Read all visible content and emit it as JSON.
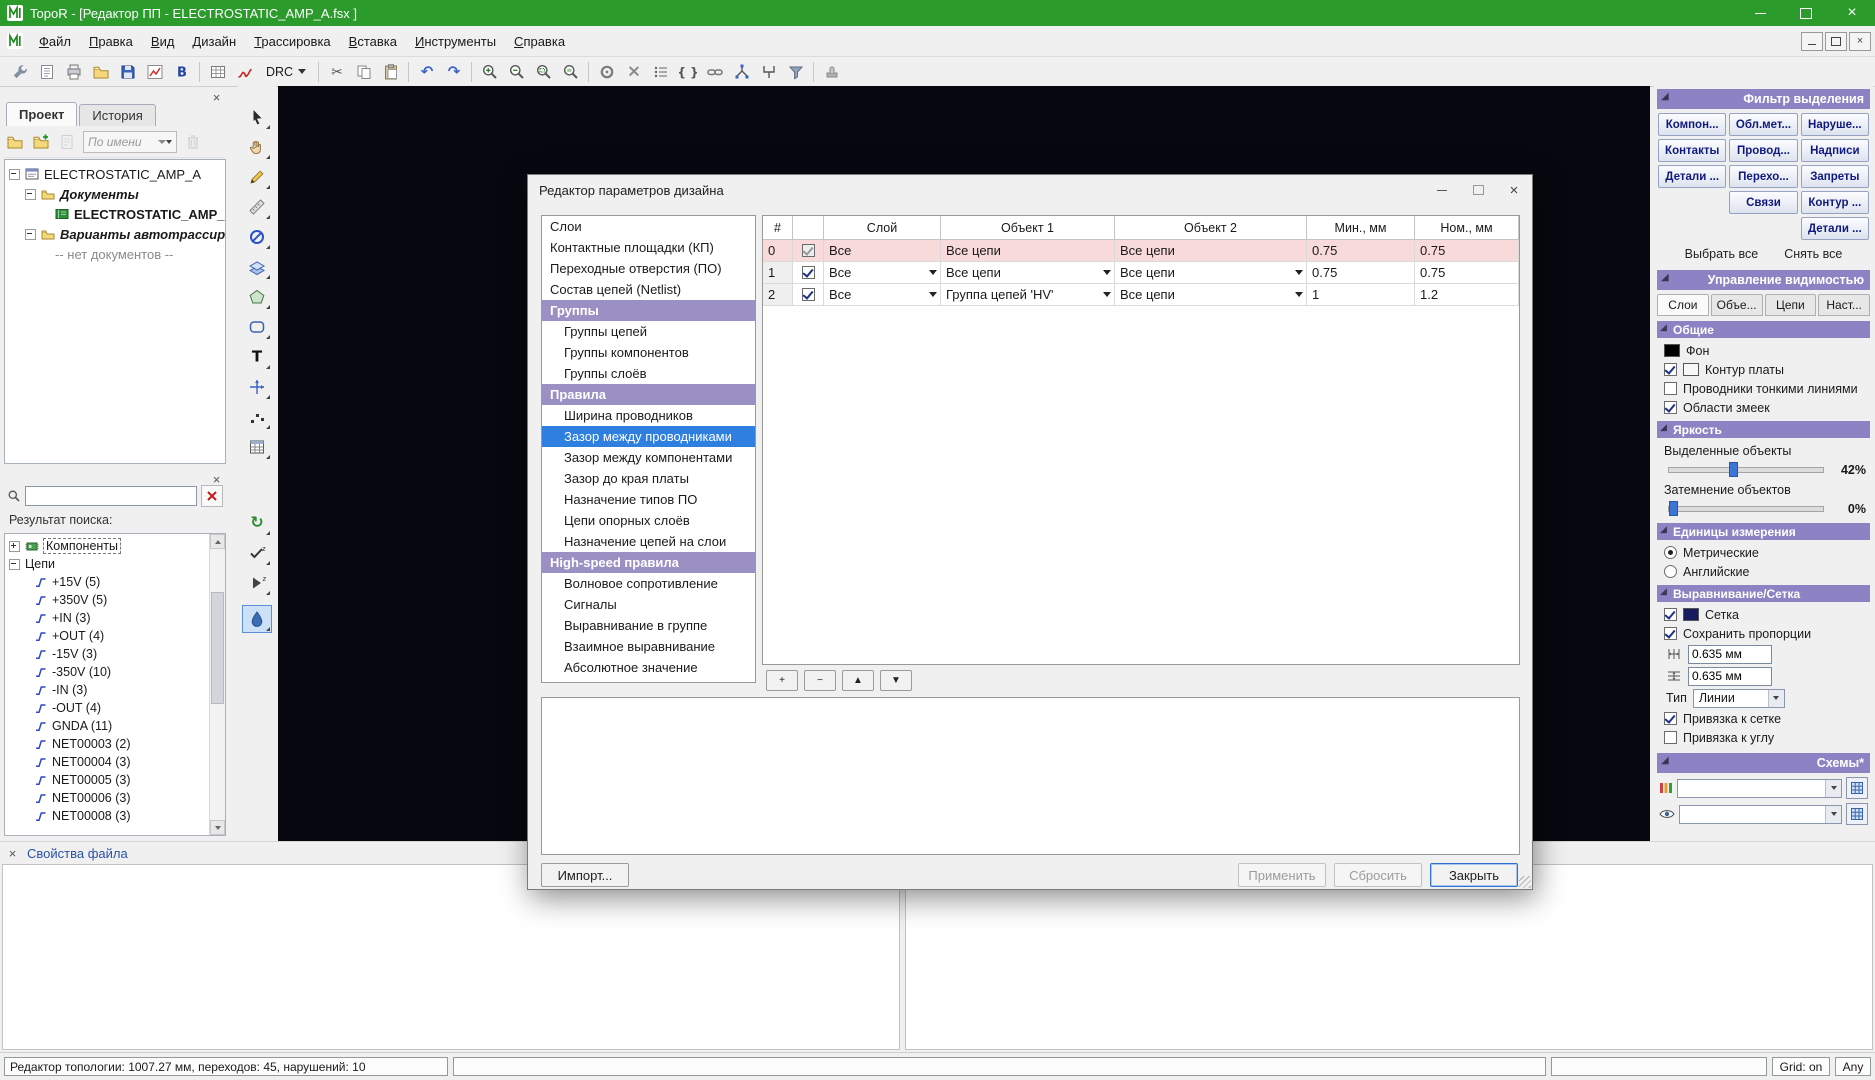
{
  "window": {
    "title": "TopoR - [Редактор ПП - ELECTROSTATIC_AMP_A.fsx ]"
  },
  "menubar": {
    "items": [
      "Файл",
      "Правка",
      "Вид",
      "Дизайн",
      "Трассировка",
      "Вставка",
      "Инструменты",
      "Справка"
    ]
  },
  "toolbar": {
    "drc_label": "DRC",
    "icons": [
      "wrench",
      "report",
      "printer",
      "folder",
      "save",
      "chart",
      "bexp",
      "|",
      "grid",
      "penred",
      "DRC",
      "|",
      "cut",
      "copy",
      "paste",
      "|",
      "undo",
      "redo",
      "|",
      "zoomin",
      "zoomout",
      "zoomsel",
      "zoomfit",
      "|",
      "via",
      "xdel",
      "list",
      "braces",
      "chain",
      "treey",
      "fork",
      "funnel",
      "|",
      "stamp"
    ]
  },
  "vtoolbar": {
    "tools": [
      "cursor",
      "hand",
      "pencil",
      "ruler",
      "noentry",
      "layers",
      "polygon",
      "roundrect",
      "textT",
      "axes",
      "dots",
      "tablegrid"
    ],
    "group2": [
      "refresh",
      "checkz",
      "playz"
    ],
    "selected_tool": "drop"
  },
  "project": {
    "tabs": [
      {
        "label": "Проект",
        "active": true
      },
      {
        "label": "История",
        "active": false
      }
    ],
    "filter_label": "По имени",
    "tree": [
      {
        "indent": 0,
        "exp": "minus",
        "icon": "rootdoc",
        "label": "ELECTROSTATIC_AMP_A",
        "cls": ""
      },
      {
        "indent": 1,
        "exp": "minus",
        "icon": "folder14",
        "label": "Документы",
        "cls": "folder"
      },
      {
        "indent": 2,
        "exp": "",
        "icon": "board",
        "label": "ELECTROSTATIC_AMP_A",
        "cls": "bold"
      },
      {
        "indent": 1,
        "exp": "minus",
        "icon": "folder14",
        "label": "Варианты автотрассировки",
        "cls": "folder"
      },
      {
        "indent": 2,
        "exp": "",
        "icon": "",
        "label": "-- нет документов --",
        "cls": "muted"
      }
    ]
  },
  "search": {
    "results_label": "Результат поиска:",
    "roots": [
      {
        "exp": "plus",
        "icon": "component",
        "label": "Компоненты",
        "focused": true
      },
      {
        "exp": "minus",
        "icon": "",
        "label": "Цепи",
        "focused": false
      }
    ],
    "nets": [
      "+15V (5)",
      "+350V (5)",
      "+IN (3)",
      "+OUT (4)",
      "-15V (3)",
      "-350V (10)",
      "-IN (3)",
      "-OUT (4)",
      "GNDA (11)",
      "NET00003 (2)",
      "NET00004 (3)",
      "NET00005 (3)",
      "NET00006 (3)",
      "NET00008 (3)"
    ]
  },
  "dialog": {
    "title": "Редактор параметров дизайна",
    "nav": [
      {
        "label": "Слои",
        "type": "item"
      },
      {
        "label": "Контактные площадки (КП)",
        "type": "item"
      },
      {
        "label": "Переходные отверстия (ПО)",
        "type": "item"
      },
      {
        "label": "Состав цепей (Netlist)",
        "type": "item"
      },
      {
        "label": "Группы",
        "type": "header"
      },
      {
        "label": "Группы цепей",
        "type": "sub"
      },
      {
        "label": "Группы компонентов",
        "type": "sub"
      },
      {
        "label": "Группы слоёв",
        "type": "sub"
      },
      {
        "label": "Правила",
        "type": "header"
      },
      {
        "label": "Ширина проводников",
        "type": "sub"
      },
      {
        "label": "Зазор между проводниками",
        "type": "sub selected"
      },
      {
        "label": "Зазор между компонентами",
        "type": "sub"
      },
      {
        "label": "Зазор до края платы",
        "type": "sub"
      },
      {
        "label": "Назначение типов ПО",
        "type": "sub"
      },
      {
        "label": "Цепи опорных слоёв",
        "type": "sub"
      },
      {
        "label": "Назначение цепей на слои",
        "type": "sub"
      },
      {
        "label": "High-speed правила",
        "type": "header"
      },
      {
        "label": "Волновое сопротивление",
        "type": "sub"
      },
      {
        "label": "Сигналы",
        "type": "sub"
      },
      {
        "label": "Выравнивание в группе",
        "type": "sub"
      },
      {
        "label": "Взаимное выравнивание",
        "type": "sub"
      },
      {
        "label": "Абсолютное значение",
        "type": "sub"
      }
    ],
    "table": {
      "headers": [
        "#",
        "",
        "Слой",
        "Объект 1",
        "Объект 2",
        "Мин., мм",
        "Ном., мм"
      ],
      "rows": [
        {
          "n": "0",
          "checked": true,
          "gray": true,
          "layer": "Все",
          "obj1": "Все цепи",
          "obj2": "Все цепи",
          "min": "0.75",
          "nom": "0.75",
          "pink": true,
          "dd": false
        },
        {
          "n": "1",
          "checked": true,
          "gray": false,
          "layer": "Все",
          "obj1": "Все цепи",
          "obj2": "Все цепи",
          "min": "0.75",
          "nom": "0.75",
          "pink": false,
          "dd": true
        },
        {
          "n": "2",
          "checked": true,
          "gray": false,
          "layer": "Все",
          "obj1": "Группа цепей 'HV'",
          "obj2": "Все цепи",
          "min": "1",
          "nom": "1.2",
          "pink": false,
          "dd": true
        }
      ]
    },
    "row_buttons": [
      "+",
      "−",
      "▲",
      "▼"
    ],
    "buttons": {
      "import": "Импорт...",
      "apply": "Применить",
      "reset": "Сбросить",
      "close": "Закрыть"
    }
  },
  "filter_panel": {
    "title": "Фильтр выделения",
    "rows": [
      [
        "Компон...",
        "Обл.мет...",
        "Наруше..."
      ],
      [
        "Контакты",
        "Провод...",
        "Надписи"
      ],
      [
        "Детали ...",
        "Перехо...",
        "Запреты"
      ],
      [
        "",
        "Связи",
        "Контур ..."
      ],
      [
        "",
        "",
        "Детали ..."
      ]
    ],
    "select_all": "Выбрать все",
    "clear_all": "Снять все"
  },
  "visibility": {
    "title": "Управление видимостью",
    "tabs": [
      {
        "label": "Слои",
        "active": true
      },
      {
        "label": "Объе...",
        "active": false
      },
      {
        "label": "Цепи",
        "active": false
      },
      {
        "label": "Наст...",
        "active": false
      }
    ],
    "general": {
      "title": "Общие",
      "items": [
        {
          "swatch": "#000000",
          "label": "Фон"
        },
        {
          "check": true,
          "swatch": "#f8f8f8",
          "label": "Контур платы"
        },
        {
          "check": false,
          "label": "Проводники тонкими линиями"
        },
        {
          "check": true,
          "label": "Области змеек"
        }
      ]
    },
    "brightness": {
      "title": "Яркость",
      "sliders": [
        {
          "label": "Выделенные объекты",
          "value": 42,
          "text": "42%"
        },
        {
          "label": "Затемнение объектов",
          "value": 0,
          "text": "0%"
        }
      ]
    },
    "units": {
      "title": "Единицы измерения",
      "options": [
        {
          "label": "Метрические",
          "selected": true
        },
        {
          "label": "Английские",
          "selected": false
        }
      ]
    },
    "align": {
      "title": "Выравнивание/Сетка",
      "grid_label": "Сетка",
      "grid_checked": true,
      "grid_color": "#181a60",
      "keep_label": "Сохранить пропорции",
      "keep_checked": true,
      "step_x": "0.635 мм",
      "step_y": "0.635 мм",
      "type_label": "Тип",
      "type_value": "Линии",
      "snap_grid_label": "Привязка к сетке",
      "snap_grid_checked": true,
      "snap_angle_label": "Привязка к углу",
      "snap_angle_checked": false
    },
    "schemes": {
      "title": "Схемы*"
    }
  },
  "file_panel": {
    "title": "Свойства файла"
  },
  "statusbar": {
    "message": "Редактор топологии: 1007.27 мм, переходов: 45, нарушений: 10",
    "grid": "Grid: on",
    "angle": "Any"
  }
}
